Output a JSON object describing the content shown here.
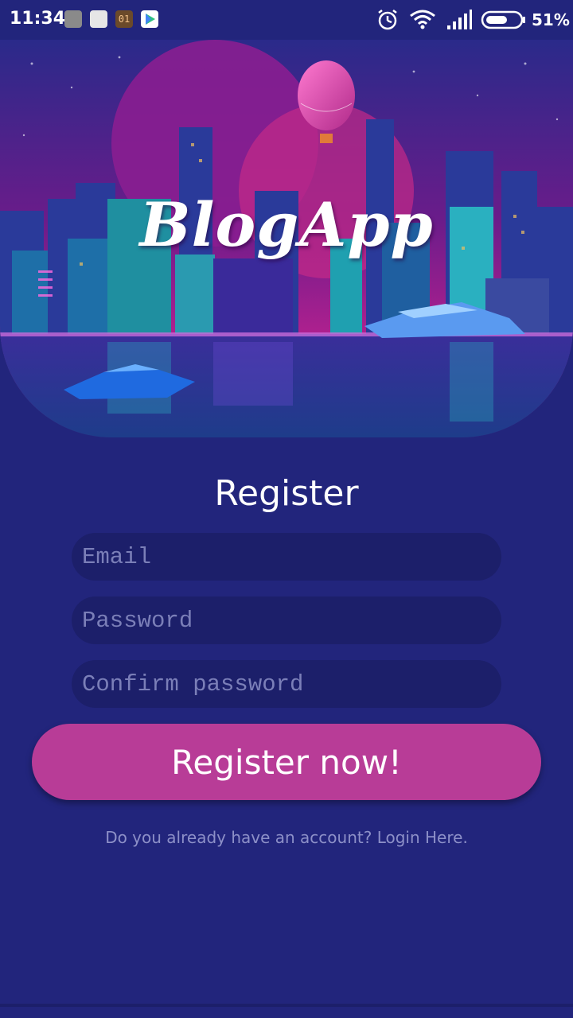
{
  "status_bar": {
    "time": "11:34",
    "notification_icons": [
      "usb-debug-icon",
      "mail-icon",
      "counter-icon",
      "play-store-icon"
    ],
    "counter_text": "01",
    "battery_percent": "51%",
    "system_icons": [
      "alarm-icon",
      "wifi-icon",
      "signal-icon",
      "battery-icon"
    ]
  },
  "hero": {
    "app_title": "BlogApp"
  },
  "form": {
    "heading": "Register",
    "email_placeholder": "Email",
    "password_placeholder": "Password",
    "confirm_placeholder": "Confirm password",
    "submit_label": "Register now!",
    "login_prompt": "Do you already have an account? Login Here."
  },
  "colors": {
    "background": "#22257c",
    "field_background": "#1c1f6a",
    "button": "#b83c97",
    "muted_text": "#8d90c8"
  }
}
